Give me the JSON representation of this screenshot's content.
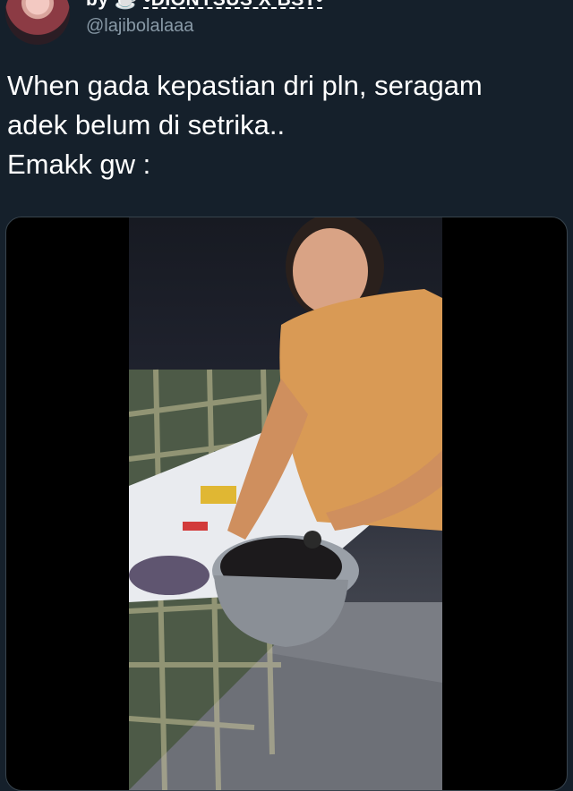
{
  "user": {
    "display_name_prefix": "by",
    "display_name_main": "•DIONYSUS X BST•",
    "handle": "@lajibolalaaa"
  },
  "tweet": {
    "lines": [
      "When gada kepastian dri pln, seragam",
      "adek belum di setrika..",
      "Emakk gw :"
    ]
  },
  "media": {
    "type": "video"
  },
  "colors": {
    "background": "#15202b",
    "text": "#ffffff",
    "secondary_text": "#8899a6"
  }
}
